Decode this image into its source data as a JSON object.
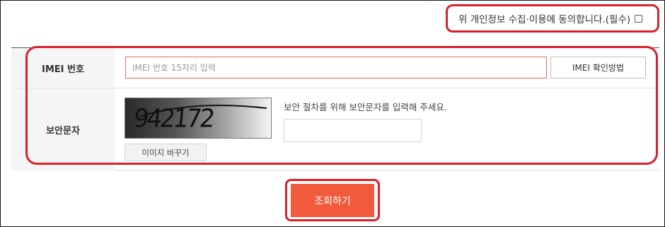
{
  "consent": {
    "label": "위 개인정보 수집·이용에 동의합니다.(필수)",
    "checked": false
  },
  "imei": {
    "label": "IMEI 번호",
    "placeholder": "IMEI 번호 15자리 입력",
    "value": "",
    "help_button": "IMEI 확인방법"
  },
  "security": {
    "label": "보안문자",
    "captcha_text": "942172",
    "refresh_button": "이미지 바꾸기",
    "description": "보안 절차를 위해 보안문자를 입력해 주세요.",
    "value": ""
  },
  "submit": {
    "label": "조회하기"
  },
  "colors": {
    "accent": "#f15a3b",
    "highlight": "#d9202b"
  }
}
